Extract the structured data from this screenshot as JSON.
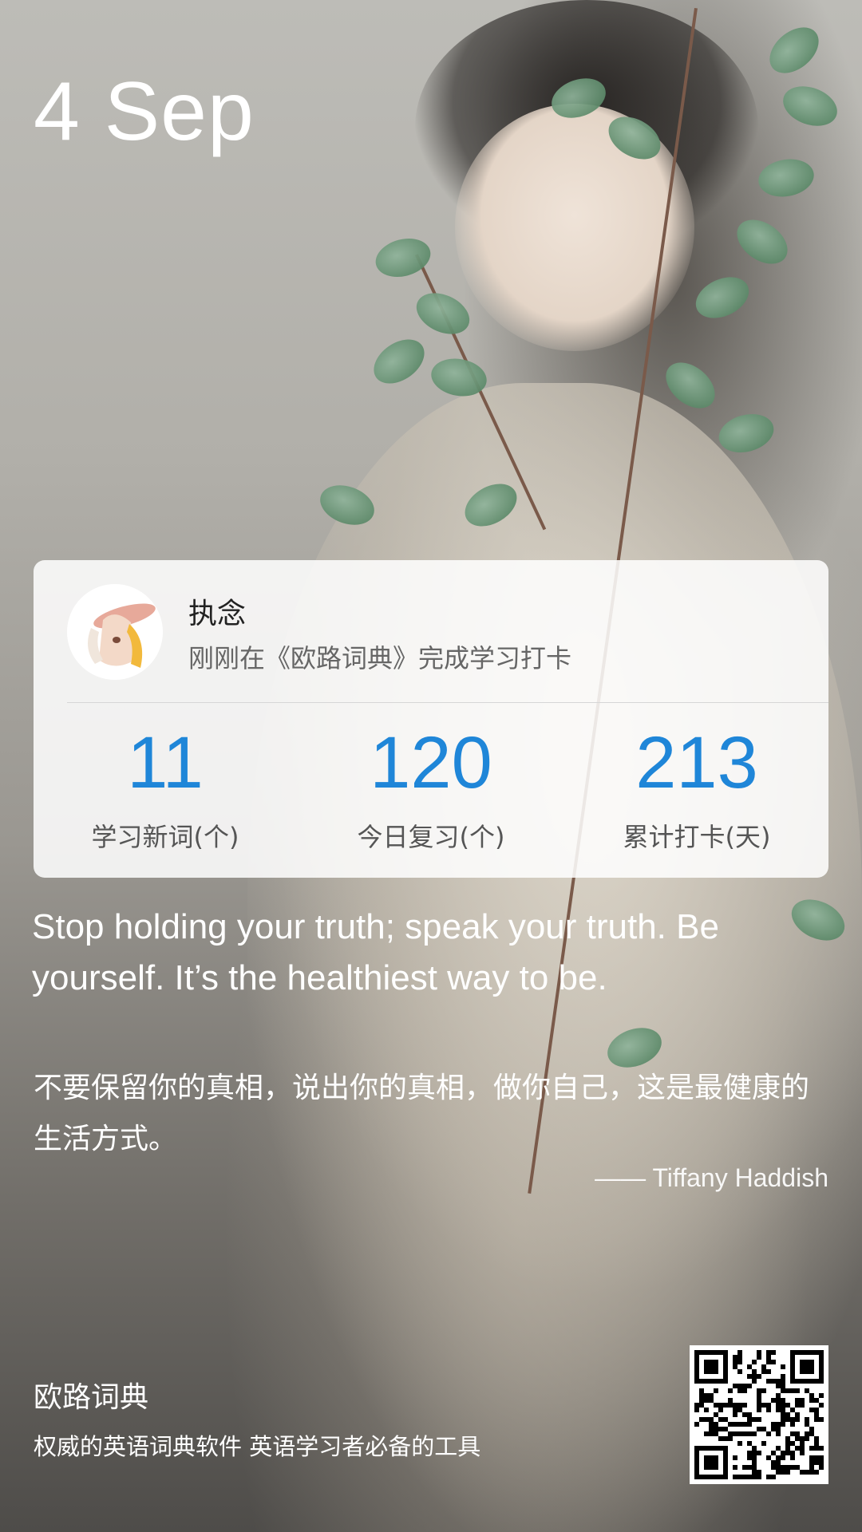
{
  "header": {
    "date": "4 Sep"
  },
  "card": {
    "user_name": "执念",
    "status": "刚刚在《欧路词典》完成学习打卡",
    "stats": [
      {
        "value": "11",
        "label": "学习新词(个)"
      },
      {
        "value": "120",
        "label": "今日复习(个)"
      },
      {
        "value": "213",
        "label": "累计打卡(天)"
      }
    ]
  },
  "quote": {
    "english": "Stop holding your truth; speak your truth. Be yourself. It’s the healthiest way to be.",
    "chinese": "不要保留你的真相，说出你的真相，做你自己，这是最健康的生活方式。",
    "author": "—— Tiffany Haddish"
  },
  "footer": {
    "brand": "欧路词典",
    "slogan": "权威的英语词典软件 英语学习者必备的工具"
  },
  "colors": {
    "accent": "#1f86d8"
  },
  "icons": {
    "avatar": "avatar-illustration",
    "qr": "qr-code-icon"
  }
}
